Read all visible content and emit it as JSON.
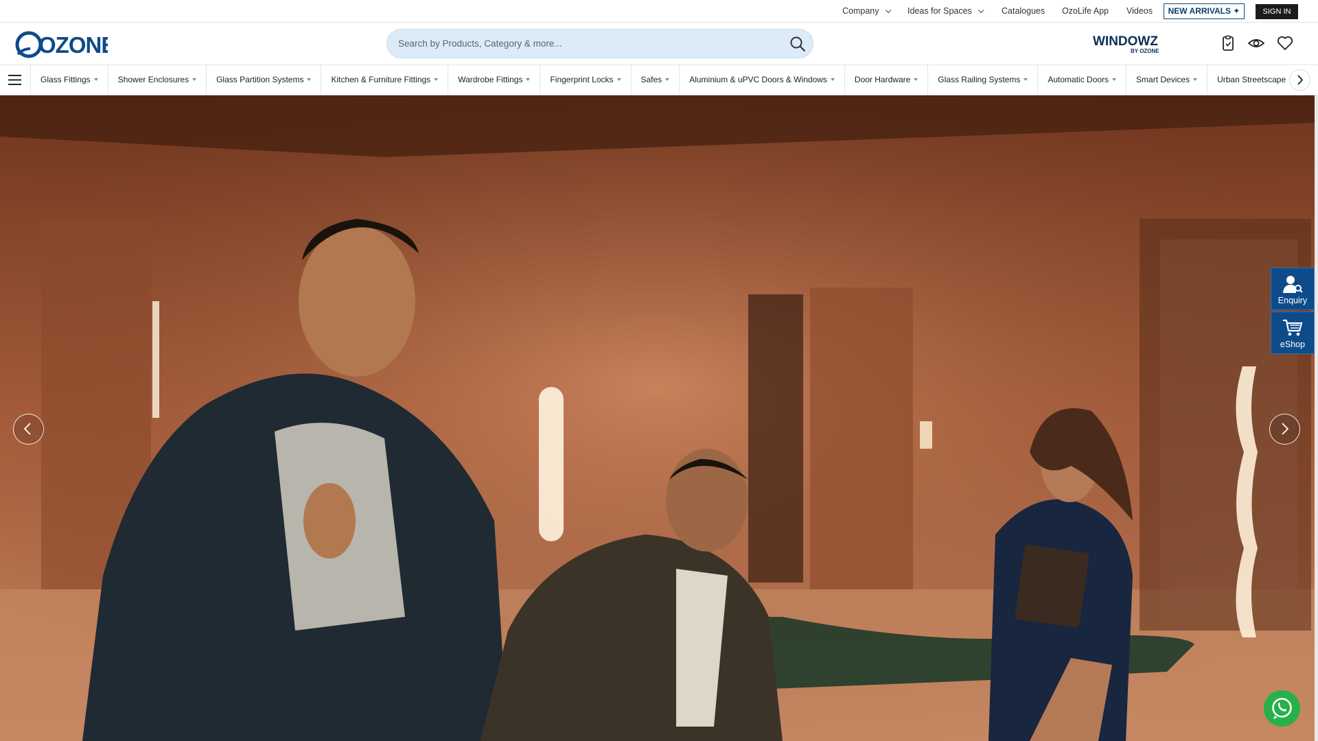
{
  "topbar": {
    "links": [
      {
        "label": "Company",
        "dropdown": true
      },
      {
        "label": "Ideas for Spaces",
        "dropdown": true
      },
      {
        "label": "Catalogues",
        "dropdown": false
      },
      {
        "label": "OzoLife App",
        "dropdown": false
      },
      {
        "label": "Videos",
        "dropdown": false
      }
    ],
    "new_arrivals_label": "NEW ARRIVALS ✦",
    "sign_in_label": "SIGN IN"
  },
  "header": {
    "logo_text": "OZONE",
    "search_placeholder": "Search by Products, Category & more...",
    "windowz_logo_text": "WINDOWZ",
    "windowz_sub": "BY OZONE",
    "icons": [
      "clipboard-icon",
      "eye-icon",
      "heart-icon"
    ]
  },
  "categories": [
    "Glass Fittings",
    "Shower Enclosures",
    "Glass Partition Systems",
    "Kitchen & Furniture Fittings",
    "Wardrobe Fittings",
    "Fingerprint Locks",
    "Safes",
    "Aluminium & uPVC Doors & Windows",
    "Door Hardware",
    "Glass Railing Systems",
    "Automatic Doors",
    "Smart Devices",
    "Urban Streetscape"
  ],
  "side_buttons": {
    "enquiry": "Enquiry",
    "eshop": "eShop"
  },
  "slider": {
    "total_slides": 2,
    "active_slide": 1
  },
  "colors": {
    "brand_blue": "#0e4b8a",
    "search_bg": "#ddebf8",
    "whatsapp": "#26b14a"
  }
}
